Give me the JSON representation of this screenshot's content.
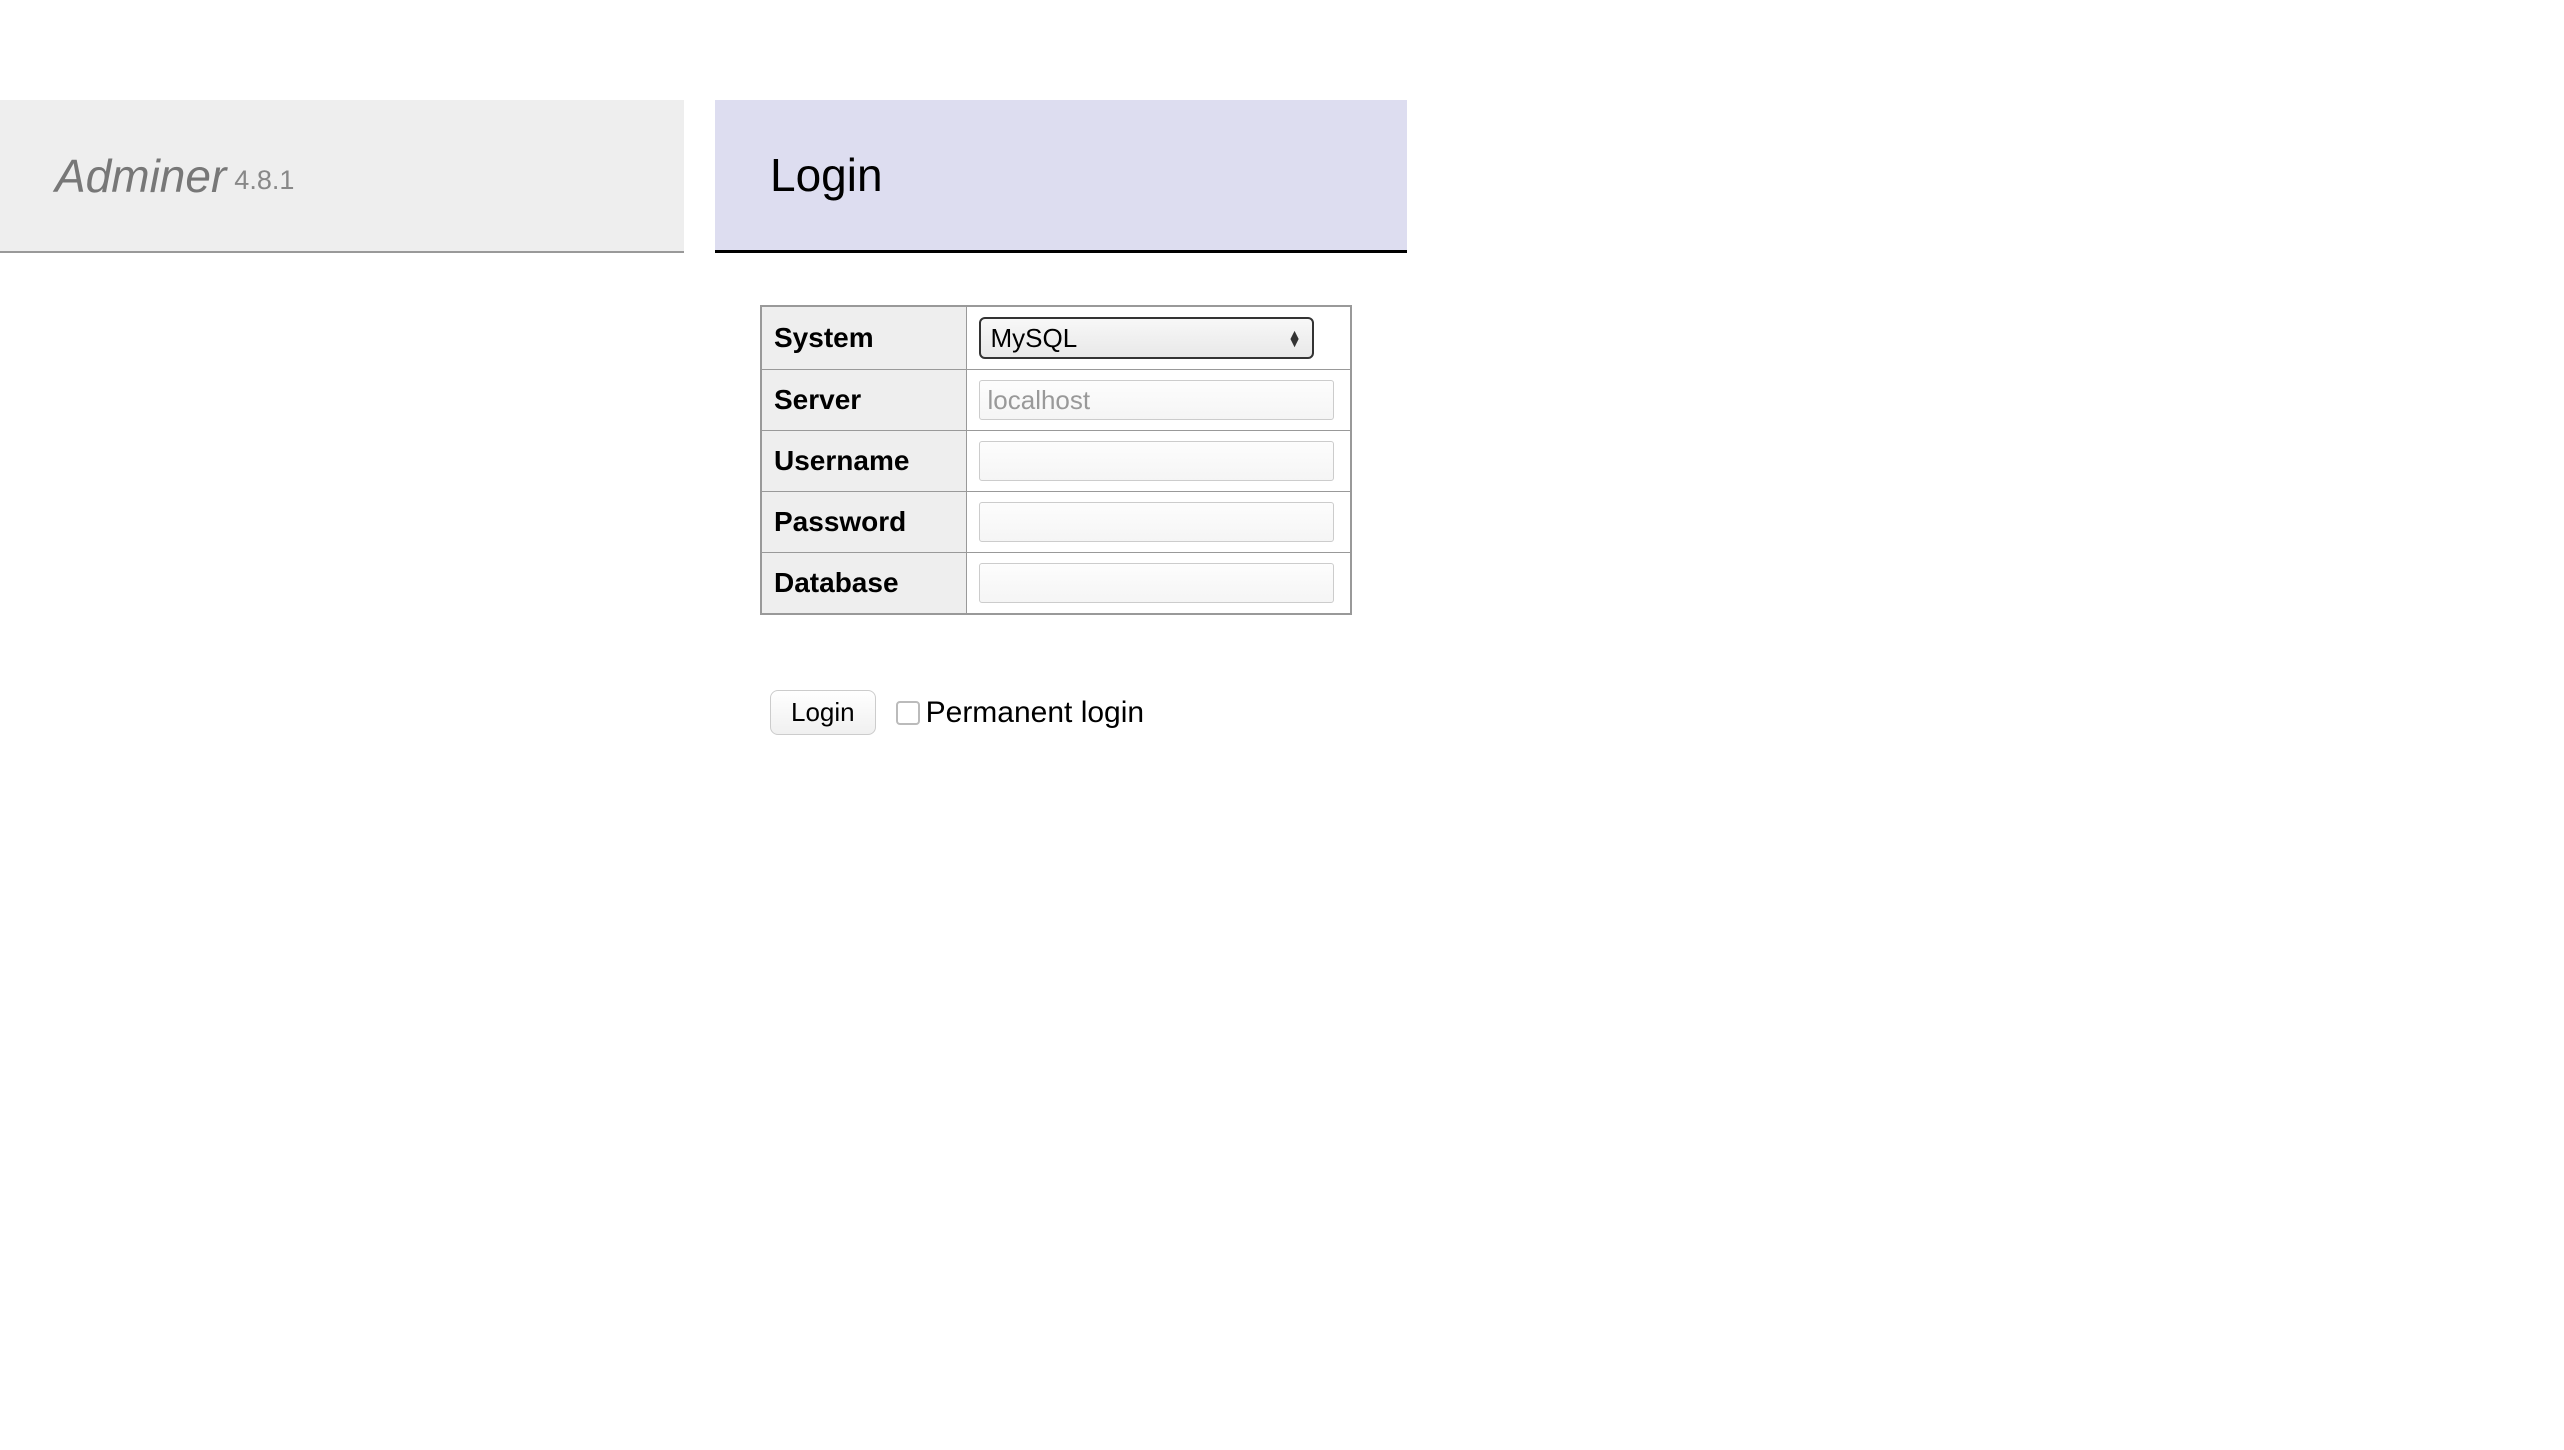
{
  "sidebar": {
    "app_name": "Adminer",
    "app_version": "4.8.1"
  },
  "header": {
    "title": "Login"
  },
  "form": {
    "fields": {
      "system": {
        "label": "System",
        "selected": "MySQL"
      },
      "server": {
        "label": "Server",
        "placeholder": "localhost",
        "value": ""
      },
      "username": {
        "label": "Username",
        "value": ""
      },
      "password": {
        "label": "Password",
        "value": ""
      },
      "database": {
        "label": "Database",
        "value": ""
      }
    },
    "submit_label": "Login",
    "permanent_label": "Permanent login",
    "permanent_checked": false
  }
}
